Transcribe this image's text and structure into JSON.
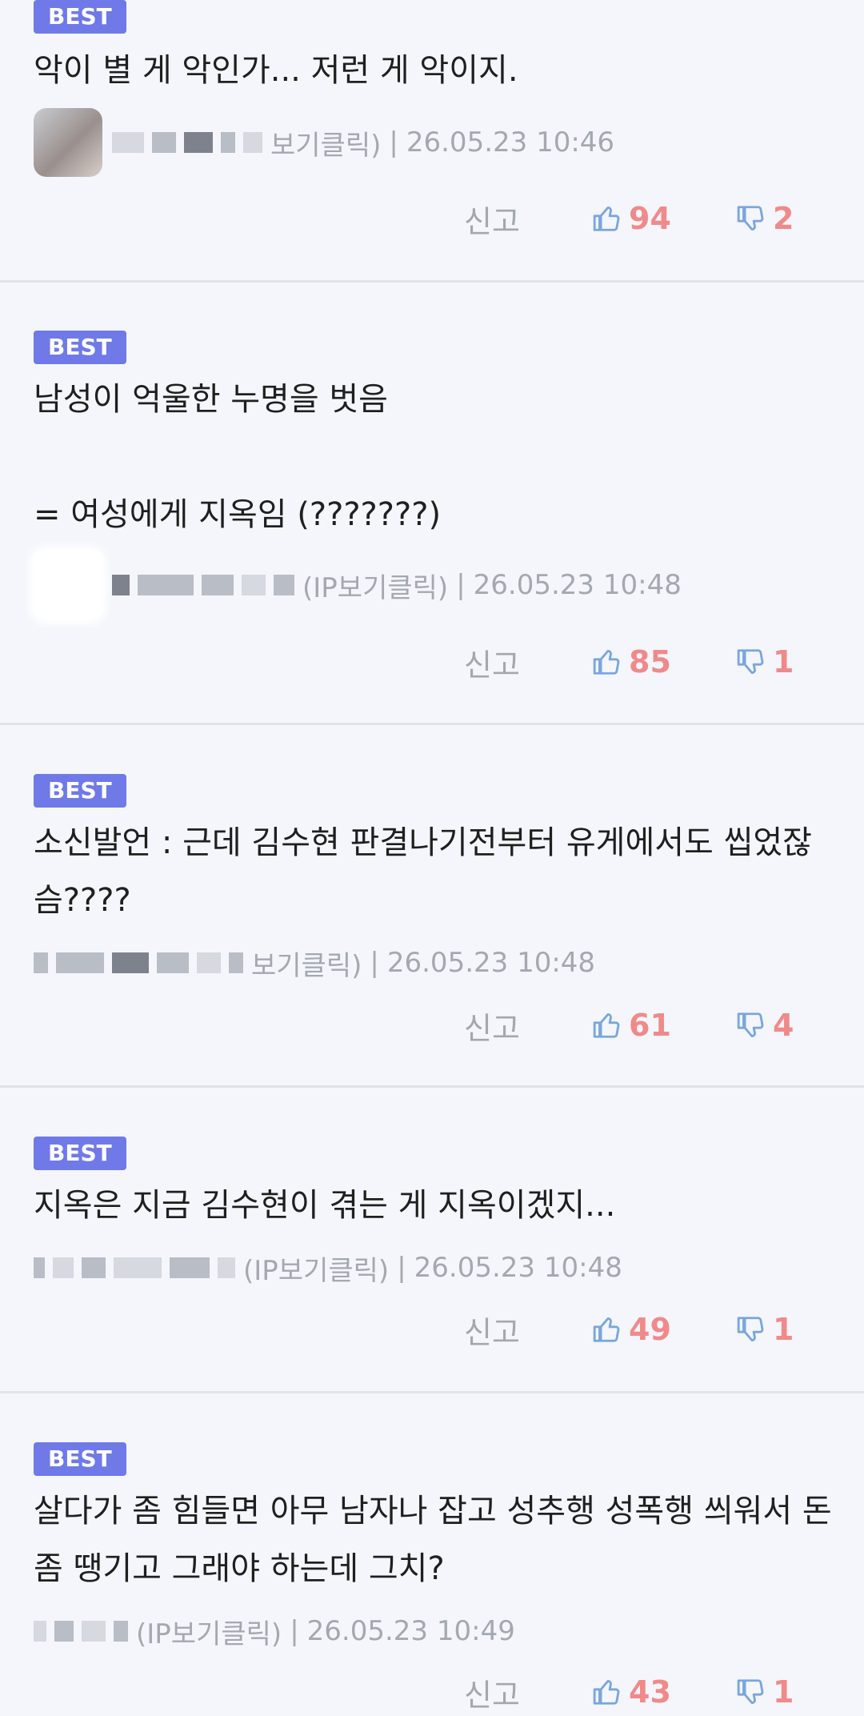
{
  "colors": {
    "badge": "#6f7ae8",
    "vote_count": "#f08a8a",
    "thumb_icon": "#7aa6de",
    "meta": "#a4a8b0"
  },
  "icons": {
    "up": "thumbs-up-icon",
    "down": "thumbs-down-icon"
  },
  "comments": [
    {
      "badge": "BEST",
      "text": "악이 별 게 악인가... 저런 게 악이지.",
      "author_suffix": "보기클릭)",
      "separator": "|",
      "date": "26.05.23 10:46",
      "report": "신고",
      "likes": "94",
      "dislikes": "2"
    },
    {
      "badge": "BEST",
      "text": "남성이 억울한 누명을 벗음\n\n= 여성에게 지옥임 (???????)",
      "author_suffix": "(IP보기클릭)",
      "separator": "|",
      "date": "26.05.23 10:48",
      "report": "신고",
      "likes": "85",
      "dislikes": "1"
    },
    {
      "badge": "BEST",
      "text": "소신발언 : 근데 김수현 판결나기전부터 유게에서도 씹었잖슴????",
      "author_suffix": "보기클릭)",
      "separator": "|",
      "date": "26.05.23 10:48",
      "report": "신고",
      "likes": "61",
      "dislikes": "4"
    },
    {
      "badge": "BEST",
      "text": "지옥은 지금 김수현이 겪는 게 지옥이겠지...",
      "author_suffix": "(IP보기클릭)",
      "separator": "|",
      "date": "26.05.23 10:48",
      "report": "신고",
      "likes": "49",
      "dislikes": "1"
    },
    {
      "badge": "BEST",
      "text": "살다가 좀 힘들면 아무 남자나 잡고 성추행 성폭행 씌워서 돈좀 땡기고 그래야 하는데 그치?",
      "author_suffix": "(IP보기클릭)",
      "separator": "|",
      "date": "26.05.23 10:49",
      "report": "신고",
      "likes": "43",
      "dislikes": "1"
    }
  ]
}
